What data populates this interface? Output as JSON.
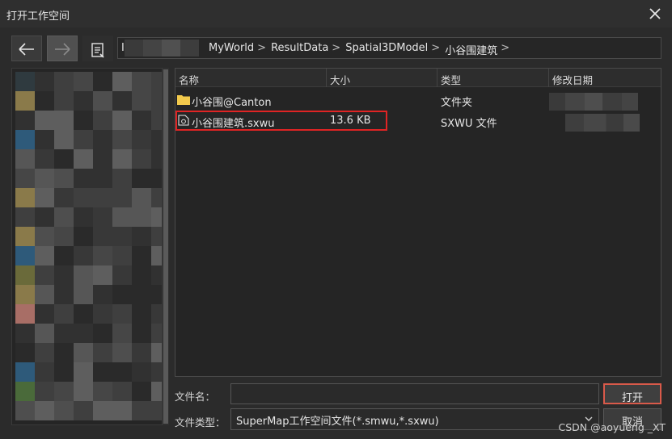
{
  "window": {
    "title": "打开工作空间"
  },
  "address_bar": {
    "crumbs": [
      "MyWorld",
      "ResultData",
      "Spatial3DModel",
      "小谷围建筑"
    ],
    "separator": ">",
    "leading_fragment": "I"
  },
  "file_list": {
    "columns": [
      "名称",
      "大小",
      "类型",
      "修改日期"
    ],
    "rows": [
      {
        "name": "小谷围@Canton",
        "size": "",
        "type": "文件夹",
        "icon": "folder-icon"
      },
      {
        "name": "小谷围建筑.sxwu",
        "size": "13.6 KB",
        "type": "SXWU 文件",
        "icon": "workspace-file-icon"
      }
    ]
  },
  "footer": {
    "filename_label": "文件名：",
    "filename_value": "",
    "filetype_label": "文件类型：",
    "filetype_value": "SuperMap工作空间文件(*.smwu,*.sxwu)",
    "open_label": "打开",
    "cancel_label": "取消"
  },
  "watermark": "CSDN @aoyueng _XT",
  "colors": {
    "background": "#2b2b2b",
    "highlight": "#e02424",
    "folder": "#f2c94c",
    "primary_border": "#d95a4a"
  }
}
